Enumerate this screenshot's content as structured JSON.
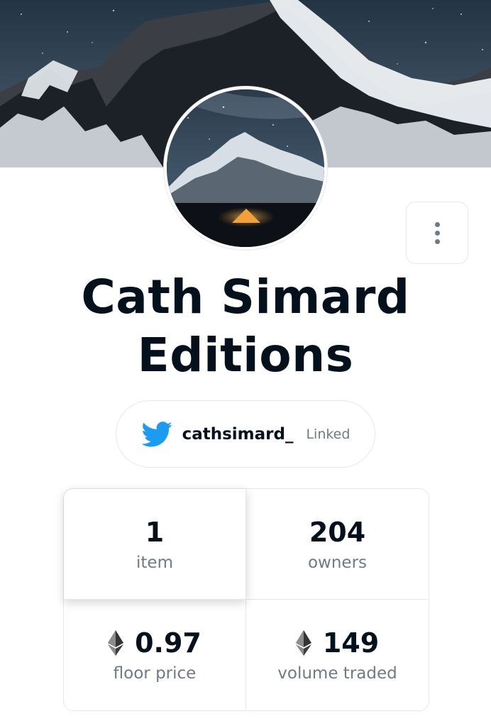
{
  "collection": {
    "name": "Cath Simard Editions"
  },
  "social": {
    "handle": "cathsimard_",
    "status": "Linked",
    "icon": "twitter-icon",
    "icon_color": "#1d9bf0"
  },
  "stats": [
    {
      "value": "1",
      "label": "item",
      "currency_icon": ""
    },
    {
      "value": "204",
      "label": "owners",
      "currency_icon": ""
    },
    {
      "value": "0.97",
      "label": "floor price",
      "currency_icon": "ethereum-icon"
    },
    {
      "value": "149",
      "label": "volume traded",
      "currency_icon": "ethereum-icon"
    }
  ],
  "menu": {
    "icon": "more-vertical-icon"
  },
  "colors": {
    "text_primary": "#04111d",
    "text_secondary": "#707a83",
    "border": "#e5e8eb"
  }
}
